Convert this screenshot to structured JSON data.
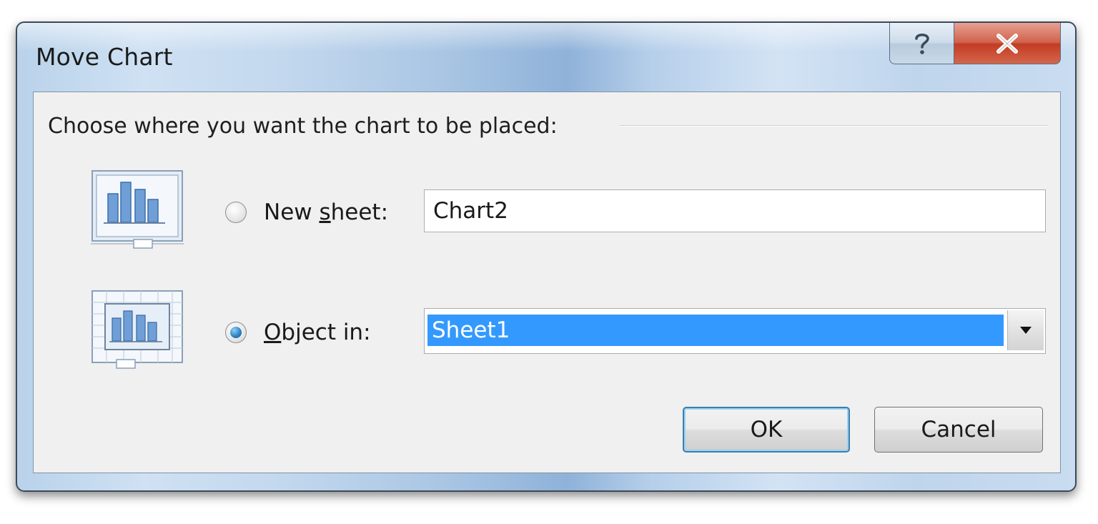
{
  "dialog": {
    "title": "Move Chart",
    "help_glyph": "?",
    "close_glyph": "X"
  },
  "group": {
    "label": "Choose where you want the chart to be placed:"
  },
  "options": {
    "new_sheet": {
      "label_pre": "New ",
      "label_mnemonic": "s",
      "label_post": "heet:",
      "value": "Chart2",
      "selected": false,
      "icon": "chart-sheet-icon"
    },
    "object_in": {
      "label_pre": "",
      "label_mnemonic": "O",
      "label_post": "bject in:",
      "value": "Sheet1",
      "selected": true,
      "icon": "embedded-chart-icon"
    }
  },
  "buttons": {
    "ok": "OK",
    "cancel": "Cancel"
  },
  "colors": {
    "selection": "#3399ff",
    "close_button": "#c23b22",
    "default_button_border": "#3c7fb1"
  }
}
